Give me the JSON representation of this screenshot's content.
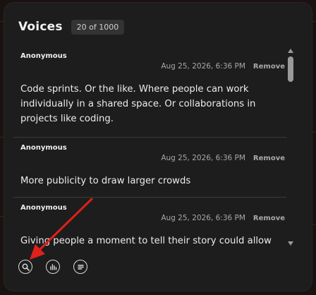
{
  "header": {
    "title": "Voices",
    "count": "20 of 1000"
  },
  "responses": [
    {
      "author": "Anonymous",
      "date": "Aug 25, 2026, 6:36 PM",
      "remove_label": "Remove",
      "text": "Code sprints. Or the like. Where people can work individually in a shared space. Or collaborations in projects like coding."
    },
    {
      "author": "Anonymous",
      "date": "Aug 25, 2026, 6:36 PM",
      "remove_label": "Remove",
      "text": "More publicity to draw larger crowds"
    },
    {
      "author": "Anonymous",
      "date": "Aug 25, 2026, 6:36 PM",
      "remove_label": "Remove",
      "text": "Giving people a moment to tell their story could allow"
    }
  ],
  "toolbar": {
    "icons": [
      "search-icon",
      "bar-chart-icon",
      "list-icon"
    ]
  },
  "colors": {
    "panel": "#1d1d1d",
    "text": "#ececec",
    "muted": "#a8a8a8",
    "annotation_arrow": "#e0201b"
  }
}
